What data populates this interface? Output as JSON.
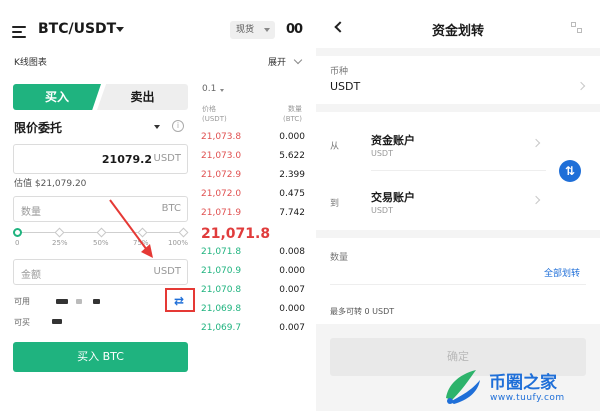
{
  "left": {
    "pair": "BTC/USDT",
    "spot_label": "现货",
    "chart_glyph": "00",
    "kline_label": "K线图表",
    "expand_label": "展开",
    "tab_buy": "买入",
    "tab_sell": "卖出",
    "order_type": "限价委托",
    "info_glyph": "i",
    "price": {
      "value": "21079.2",
      "unit": "USDT"
    },
    "estimate": "估值 $21,079.20",
    "quantity": {
      "placeholder": "数量",
      "unit": "BTC"
    },
    "slider_marks": [
      "0",
      "25%",
      "50%",
      "75%",
      "100%"
    ],
    "amount": {
      "placeholder": "金额",
      "unit": "USDT"
    },
    "available_label": "可用",
    "buyable_label": "可买",
    "swap_glyph": "⇄",
    "buy_button": "买入 BTC"
  },
  "orderbook": {
    "step": "0.1",
    "price_header": [
      "价格",
      "(USDT)"
    ],
    "qty_header": [
      "数量",
      "(BTC)"
    ],
    "asks": [
      {
        "price": "21,073.8",
        "qty": "0.000"
      },
      {
        "price": "21,073.0",
        "qty": "5.622"
      },
      {
        "price": "21,072.9",
        "qty": "2.399"
      },
      {
        "price": "21,072.0",
        "qty": "0.475"
      },
      {
        "price": "21,071.9",
        "qty": "7.742"
      }
    ],
    "mid_price": "21,071.8",
    "bids": [
      {
        "price": "21,071.8",
        "qty": "0.008"
      },
      {
        "price": "21,070.9",
        "qty": "0.000"
      },
      {
        "price": "21,070.8",
        "qty": "0.007"
      },
      {
        "price": "21,069.8",
        "qty": "0.000"
      },
      {
        "price": "21,069.7",
        "qty": "0.007"
      }
    ]
  },
  "transfer": {
    "title": "资金划转",
    "coin_label": "币种",
    "coin_value": "USDT",
    "from_label": "从",
    "from_account": "资金账户",
    "from_sub": "USDT",
    "to_label": "到",
    "to_account": "交易账户",
    "to_sub": "USDT",
    "swap_glyph": "⇅",
    "amount_label": "数量",
    "all_transfer": "全部划转",
    "max_transfer": "最多可转 0 USDT",
    "confirm": "确定"
  },
  "watermark": {
    "name": "币圈之家",
    "url": "www.tuufy.com"
  },
  "colors": {
    "accent_green": "#1fb37f",
    "ask_red": "#e05050",
    "highlight_red": "#e53935",
    "link_blue": "#1f6fd8"
  }
}
